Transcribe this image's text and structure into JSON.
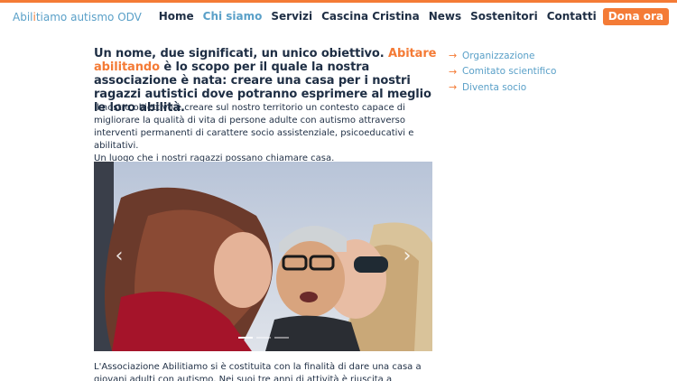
{
  "logo": {
    "part1": "Abil",
    "part2": "i",
    "part3": "tiamo",
    "part4": " autismo ODV"
  },
  "nav": {
    "home": "Home",
    "chi_siamo": "Chi siamo",
    "servizi": "Servizi",
    "cascina": "Cascina Cristina",
    "news": "News",
    "sostenitori": "Sostenitori",
    "contatti": "Contatti",
    "dona": "Dona ora"
  },
  "lead": {
    "before": "Un nome, due significati, un unico obiettivo. ",
    "highlight": "Abitare abilitando",
    "after": " è lo scopo per il quale la nostra associazione è nata: creare una casa per i nostri ragazzi autistici dove potranno esprimere al meglio le loro abilità."
  },
  "description": {
    "line1": "Il nostro obiettivo è creare sul nostro territorio un contesto capace di migliorare la qualità di vita di persone adulte con autismo attraverso interventi permanenti di carattere socio assistenziale, psicoeducativi e abilitativi.",
    "line2": "Un luogo che i nostri ragazzi possano chiamare casa."
  },
  "sidebar": {
    "items": [
      {
        "label": "Organizzazione"
      },
      {
        "label": "Comitato scientifico"
      },
      {
        "label": "Diventa socio"
      }
    ],
    "arrow": "→"
  },
  "slider": {
    "prev": "‹",
    "next": "›",
    "slide_count": 3,
    "active_slide": 1
  },
  "body2": "L'Associazione Abilitiamo si è costituita con la finalità di dare una casa a giovani adulti con autismo. Nei suoi tre anni di attività è riuscita a raggiungere alcune tappe",
  "colors": {
    "accent": "#f47b36",
    "link": "#5aa0c8",
    "text": "#1e2e44"
  }
}
